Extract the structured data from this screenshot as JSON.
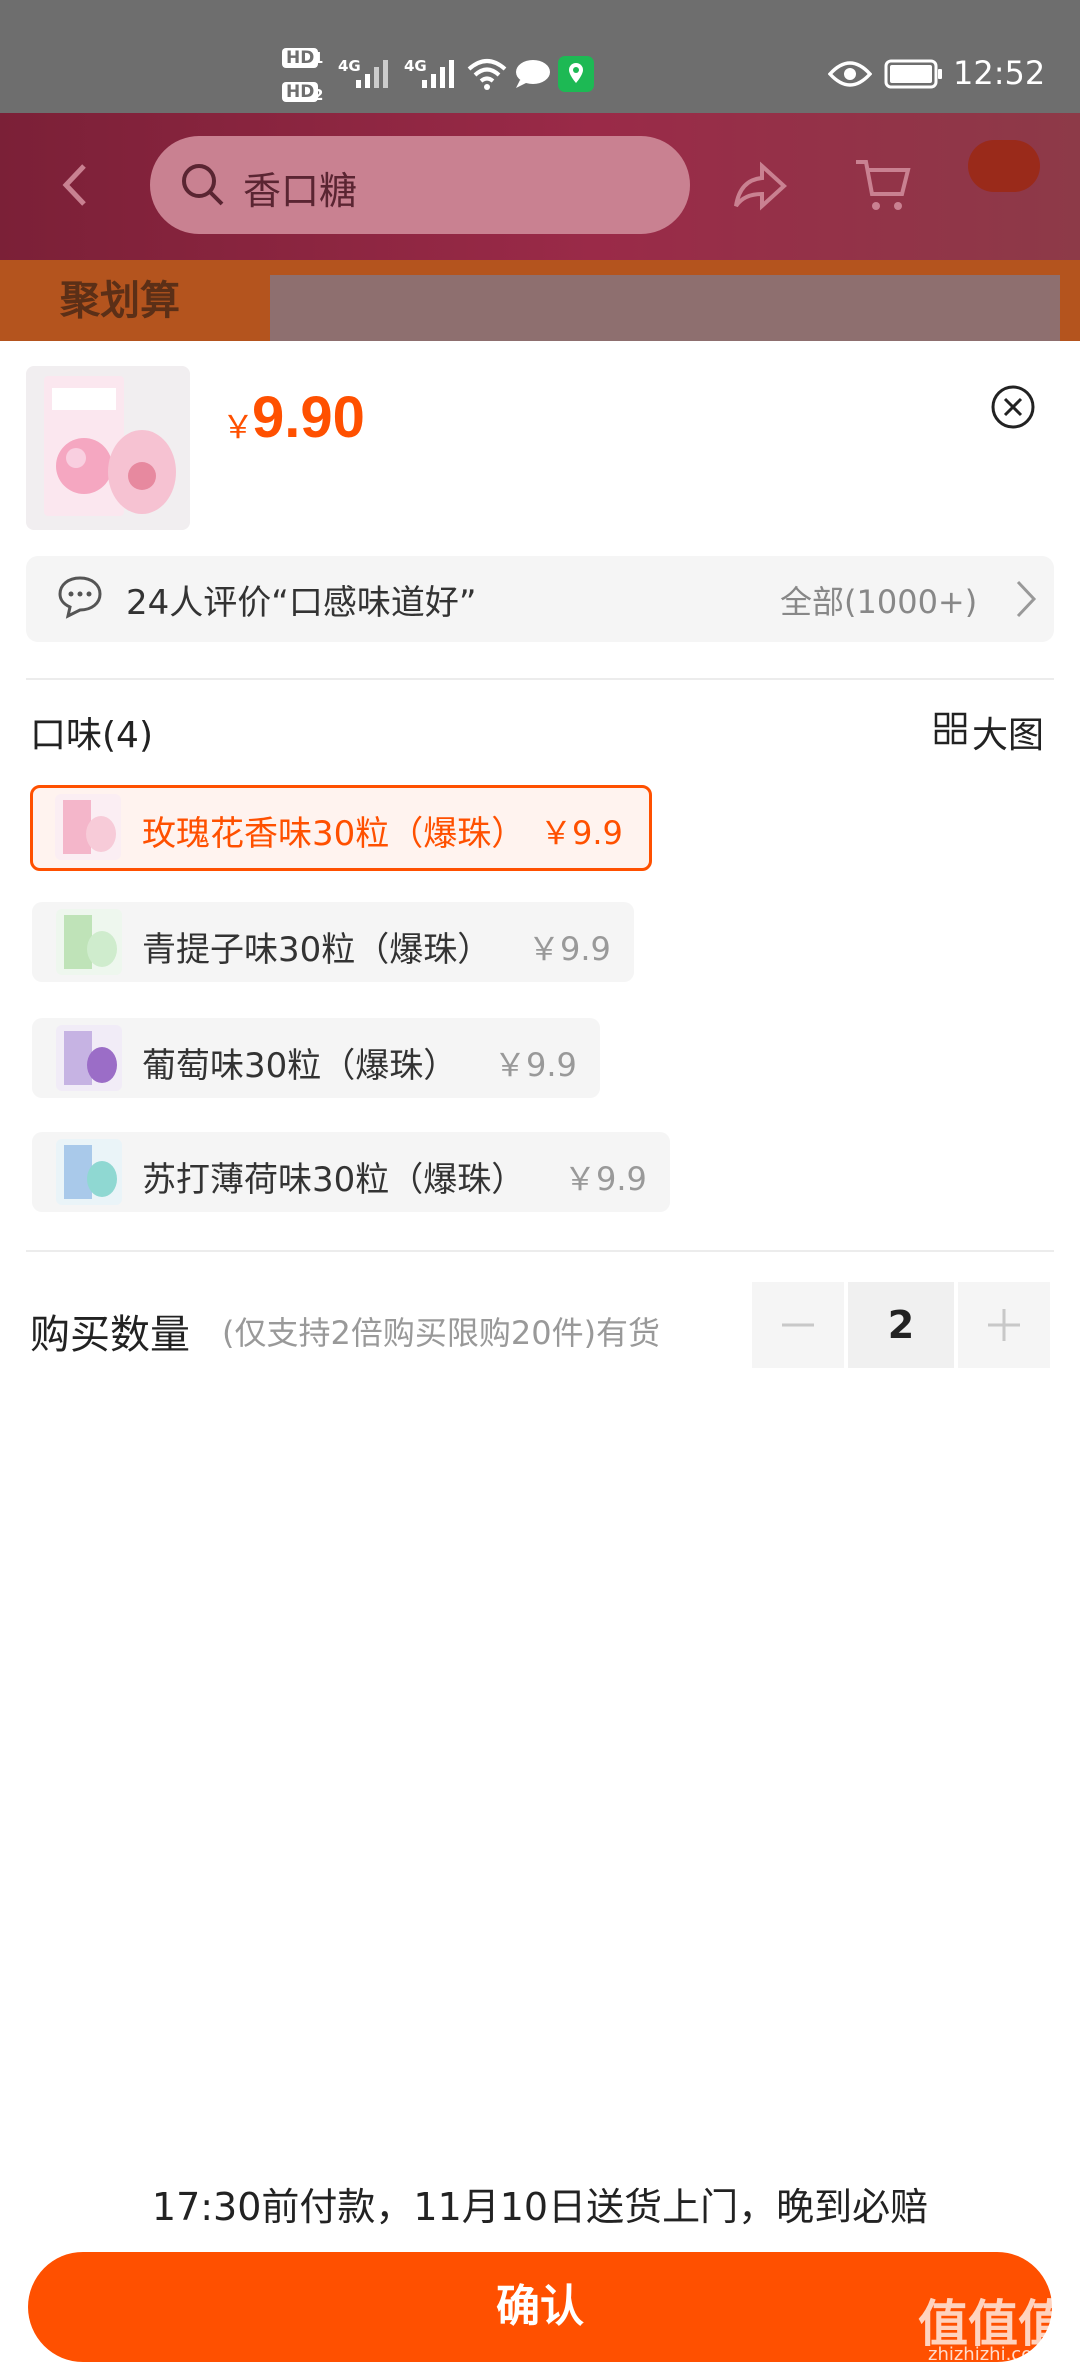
{
  "status_bar": {
    "hd1": "HD",
    "hd1_sub": "1",
    "hd2": "HD",
    "hd2_sub": "2",
    "net1": "4G",
    "net2": "4G",
    "time": "12:52"
  },
  "background_page": {
    "search_text": "香口糖",
    "banner_text": "聚划算"
  },
  "product": {
    "price_symbol": "￥",
    "price": "9.90"
  },
  "review": {
    "text": "24人评价“口感味道好”",
    "count": "全部(1000+)"
  },
  "flavor": {
    "label": "口味(4)",
    "big_image": "大图",
    "options": [
      {
        "label": "玫瑰花香味30粒（爆珠）",
        "price": "￥9.9",
        "selected": true
      },
      {
        "label": "青提子味30粒（爆珠）",
        "price": "￥9.9",
        "selected": false
      },
      {
        "label": "葡萄味30粒（爆珠）",
        "price": "￥9.9",
        "selected": false
      },
      {
        "label": "苏打薄荷味30粒（爆珠）",
        "price": "￥9.9",
        "selected": false
      }
    ]
  },
  "quantity": {
    "label": "购买数量",
    "note": "(仅支持2倍购买限购20件)有货",
    "value": "2",
    "minus": "−",
    "plus": "+"
  },
  "delivery_note": "17:30前付款，11月10日送货上门，晚到必赔",
  "confirm_label": "确认",
  "watermark": {
    "main": "值值值",
    "sub": "zhizhizhi.com"
  },
  "colors": {
    "accent": "#ff5000",
    "status_bar": "#6e6e6e"
  },
  "icons": [
    "back-icon",
    "search-icon",
    "share-icon",
    "cart-icon",
    "more-icon",
    "close-icon",
    "comment-icon",
    "chevron-right-icon",
    "grid-icon",
    "wifi-icon",
    "eye-icon",
    "battery-icon",
    "location-icon",
    "message-icon"
  ]
}
